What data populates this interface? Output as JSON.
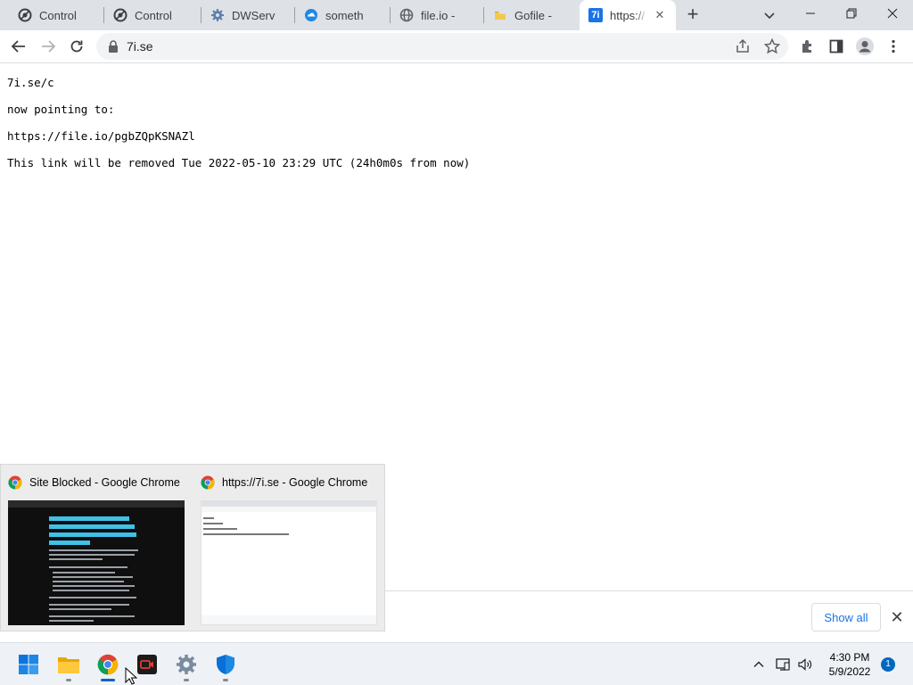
{
  "browser": {
    "tabs": [
      {
        "title": "Control",
        "icon": "control-icon",
        "active": false
      },
      {
        "title": "Control",
        "icon": "control-icon",
        "active": false
      },
      {
        "title": "DWServ",
        "icon": "gear-icon",
        "active": false
      },
      {
        "title": "someth",
        "icon": "cloud-icon",
        "active": false
      },
      {
        "title": "file.io -",
        "icon": "globe-icon",
        "active": false
      },
      {
        "title": "Gofile -",
        "icon": "folder-icon",
        "active": false
      },
      {
        "title": "https://",
        "icon": "7i-icon",
        "active": true
      }
    ],
    "favicon_7i_text": "7i",
    "new_tab_label": "+",
    "address_bar": {
      "url": "7i.se"
    }
  },
  "page": {
    "lines": [
      "7i.se/c",
      "now pointing to:",
      "https://file.io/pgbZQpKSNAZl",
      "This link will be removed Tue 2022-05-10 23:29 UTC (24h0m0s from now)"
    ]
  },
  "download_shelf": {
    "show_all_label": "Show all",
    "close_label": "✕"
  },
  "taskbar_preview": {
    "windows": [
      {
        "title": "Site Blocked - Google Chrome",
        "thumb_style": "dark"
      },
      {
        "title": "https://7i.se - Google Chrome",
        "thumb_style": "light"
      }
    ]
  },
  "taskbar": {
    "apps": [
      {
        "name": "start",
        "icon": "windows-start-icon"
      },
      {
        "name": "file-explorer",
        "icon": "folder-icon"
      },
      {
        "name": "chrome",
        "icon": "chrome-icon"
      },
      {
        "name": "recorder",
        "icon": "video-recorder-icon"
      },
      {
        "name": "settings",
        "icon": "gear-icon"
      },
      {
        "name": "defender",
        "icon": "shield-icon"
      }
    ],
    "clock": {
      "time": "4:30 PM",
      "date": "5/9/2022"
    },
    "notification_count": "1"
  },
  "colors": {
    "tabstrip_bg": "#dee1e6",
    "omnibox_bg": "#f1f3f4",
    "link_blue": "#1a73e8",
    "taskbar_bg": "#eef1f6",
    "accent": "#0067c0"
  }
}
